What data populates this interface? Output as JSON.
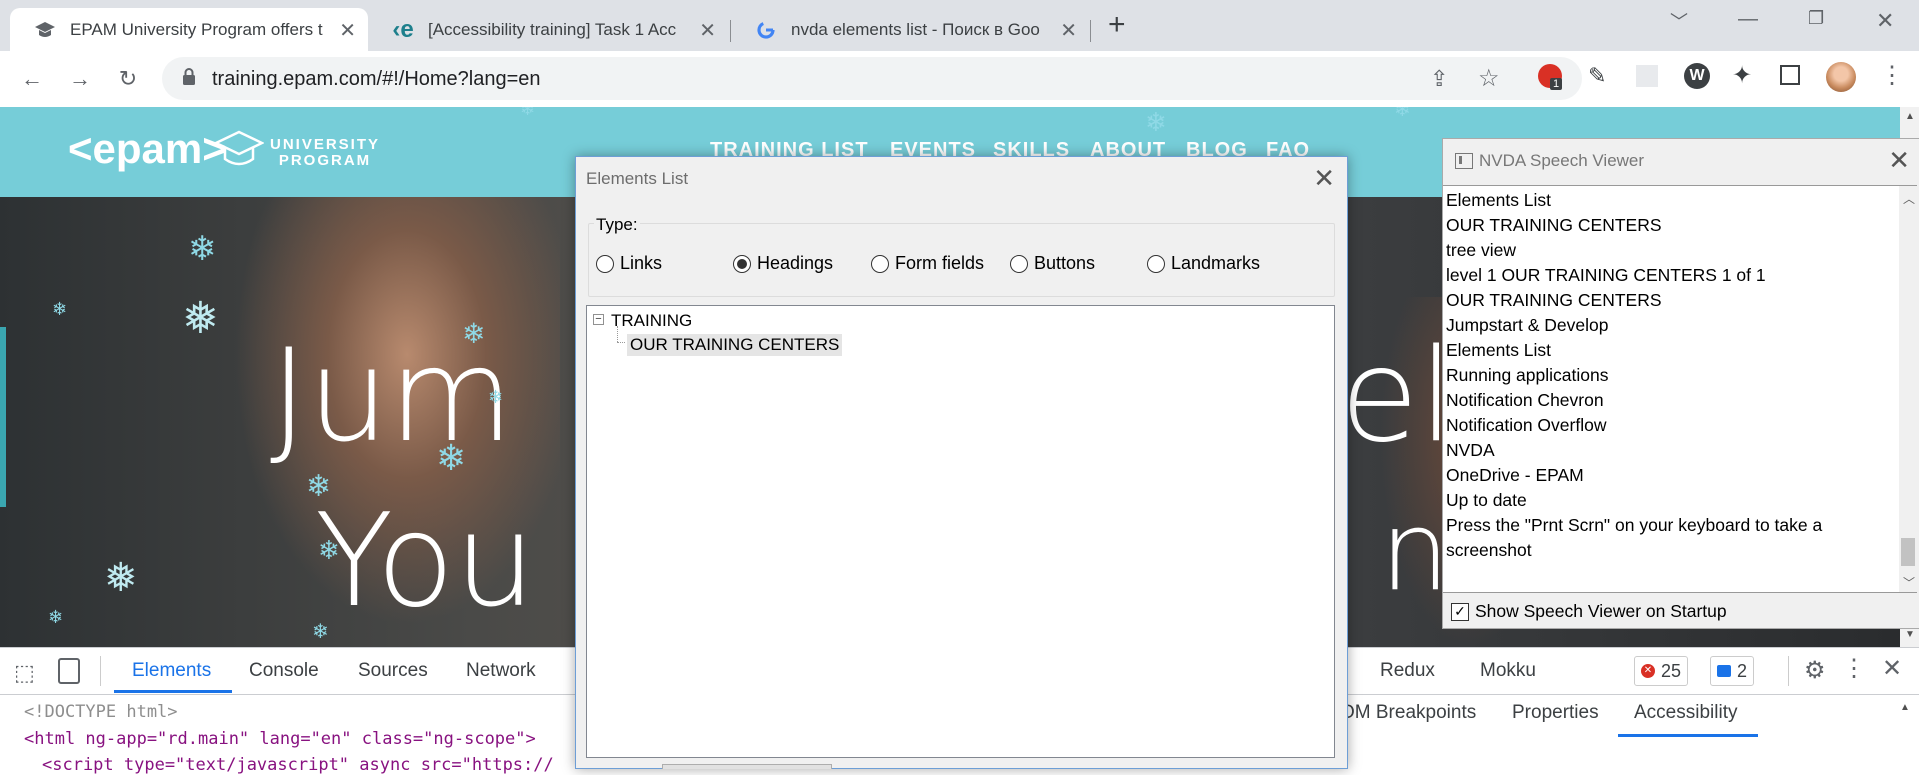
{
  "browser": {
    "tabs": [
      {
        "title": "EPAM University Program offers t",
        "active": true
      },
      {
        "title": "[Accessibility training] Task 1 Acc",
        "active": false
      },
      {
        "title": "nvda elements list - Поиск в Goo",
        "active": false
      }
    ],
    "new_tab": "+",
    "url": "training.epam.com/#!/Home?lang=en"
  },
  "site": {
    "logo_text": "<epam>",
    "logo_sub1": "UNIVERSITY",
    "logo_sub2": "PROGRAM",
    "nav": [
      "TRAINING LIST",
      "EVENTS",
      "SKILLS",
      "ABOUT",
      "BLOG",
      "FAQ"
    ],
    "hero_line1": "Jum",
    "hero_line1_right": "el",
    "hero_line2": "You",
    "hero_line2_right": "n u s"
  },
  "devtools": {
    "tabs": [
      "Elements",
      "Console",
      "Sources",
      "Network"
    ],
    "right_tabs": [
      "Redux",
      "Mokku"
    ],
    "error_count": "25",
    "message_count": "2",
    "code_lines": [
      "<!DOCTYPE html>",
      "<html ng-app=\"rd.main\" lang=\"en\" class=\"ng-scope\">",
      "<script type=\"text/javascript\" async src=\"https://"
    ],
    "sub_tabs": [
      "DOM Breakpoints",
      "Properties",
      "Accessibility"
    ],
    "sub_tab_first_visible": "OM Breakpoints"
  },
  "elements_dialog": {
    "title": "Elements List",
    "type_label": "Type:",
    "options": [
      {
        "label": "Links",
        "checked": false
      },
      {
        "label": "Headings",
        "checked": true
      },
      {
        "label": "Form fields",
        "checked": false
      },
      {
        "label": "Buttons",
        "checked": false
      },
      {
        "label": "Landmarks",
        "checked": false
      }
    ],
    "tree": {
      "root": "TRAINING",
      "child": "OUR TRAINING CENTERS"
    }
  },
  "speech_viewer": {
    "title": "NVDA Speech Viewer",
    "lines": [
      "Elements List",
      "OUR TRAINING CENTERS",
      "tree view",
      "level 1  OUR TRAINING CENTERS  1 of 1",
      "OUR TRAINING CENTERS",
      "Jumpstart & Develop",
      "Elements List",
      "Running applications",
      "Notification Chevron",
      "Notification Overflow",
      "NVDA",
      "OneDrive - EPAM",
      "Up to date",
      "Press the \"Prnt Scrn\" on your keyboard to take a",
      "screenshot"
    ],
    "startup_checkbox": "Show Speech Viewer on Startup",
    "startup_checked": true
  },
  "colors": {
    "site_header": "#76cdd8",
    "devtools_accent": "#1a73e8",
    "error_red": "#d93025"
  }
}
